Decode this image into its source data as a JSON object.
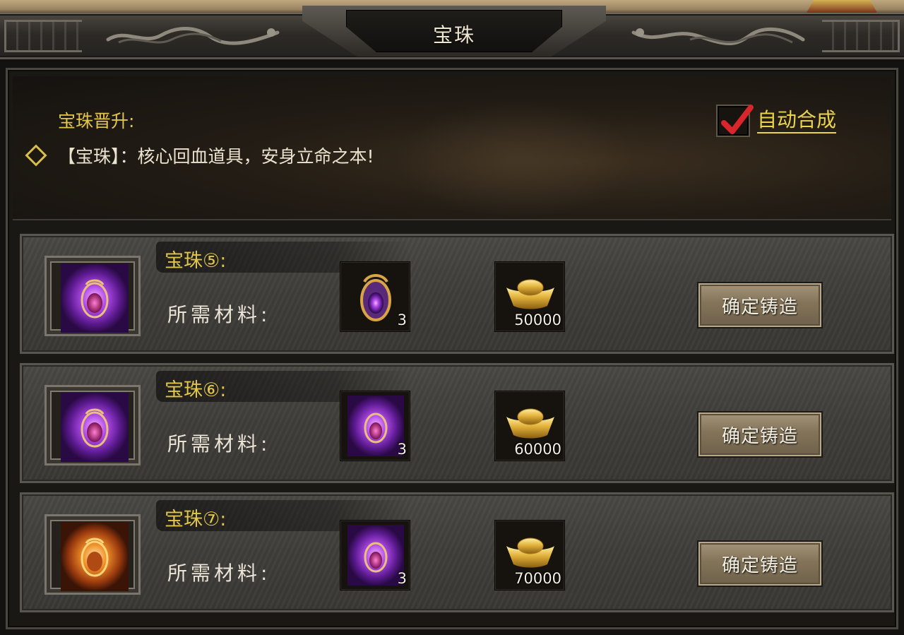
{
  "window": {
    "title": "宝珠"
  },
  "info": {
    "section_label": "宝珠晋升:",
    "description": "【宝珠】：核心回血道具，安身立命之本!"
  },
  "auto_merge": {
    "label": "自动合成",
    "checked": true
  },
  "materials_label": "所需材料:",
  "forge_button_label": "确定铸造",
  "recipes": [
    {
      "title": "宝珠⑤:",
      "result_icon": "purple-orb-icon",
      "gem_material_icon": "small-orb-icon",
      "gem_qty": "3",
      "gold_icon": "gold-ingot-icon",
      "gold_qty": "50000"
    },
    {
      "title": "宝珠⑥:",
      "result_icon": "purple-orb-icon",
      "gem_material_icon": "purple-orb-icon",
      "gem_qty": "3",
      "gold_icon": "gold-ingot-icon",
      "gold_qty": "60000"
    },
    {
      "title": "宝珠⑦:",
      "result_icon": "orange-orb-icon",
      "gem_material_icon": "purple-orb-icon",
      "gem_qty": "3",
      "gold_icon": "gold-ingot-icon",
      "gold_qty": "70000"
    }
  ],
  "colors": {
    "gold_text": "#e2c64a",
    "auto_label": "#ead44c",
    "check_red": "#d8262c",
    "orb_purple": "#9b3ee0",
    "orb_orange": "#e8781e"
  }
}
